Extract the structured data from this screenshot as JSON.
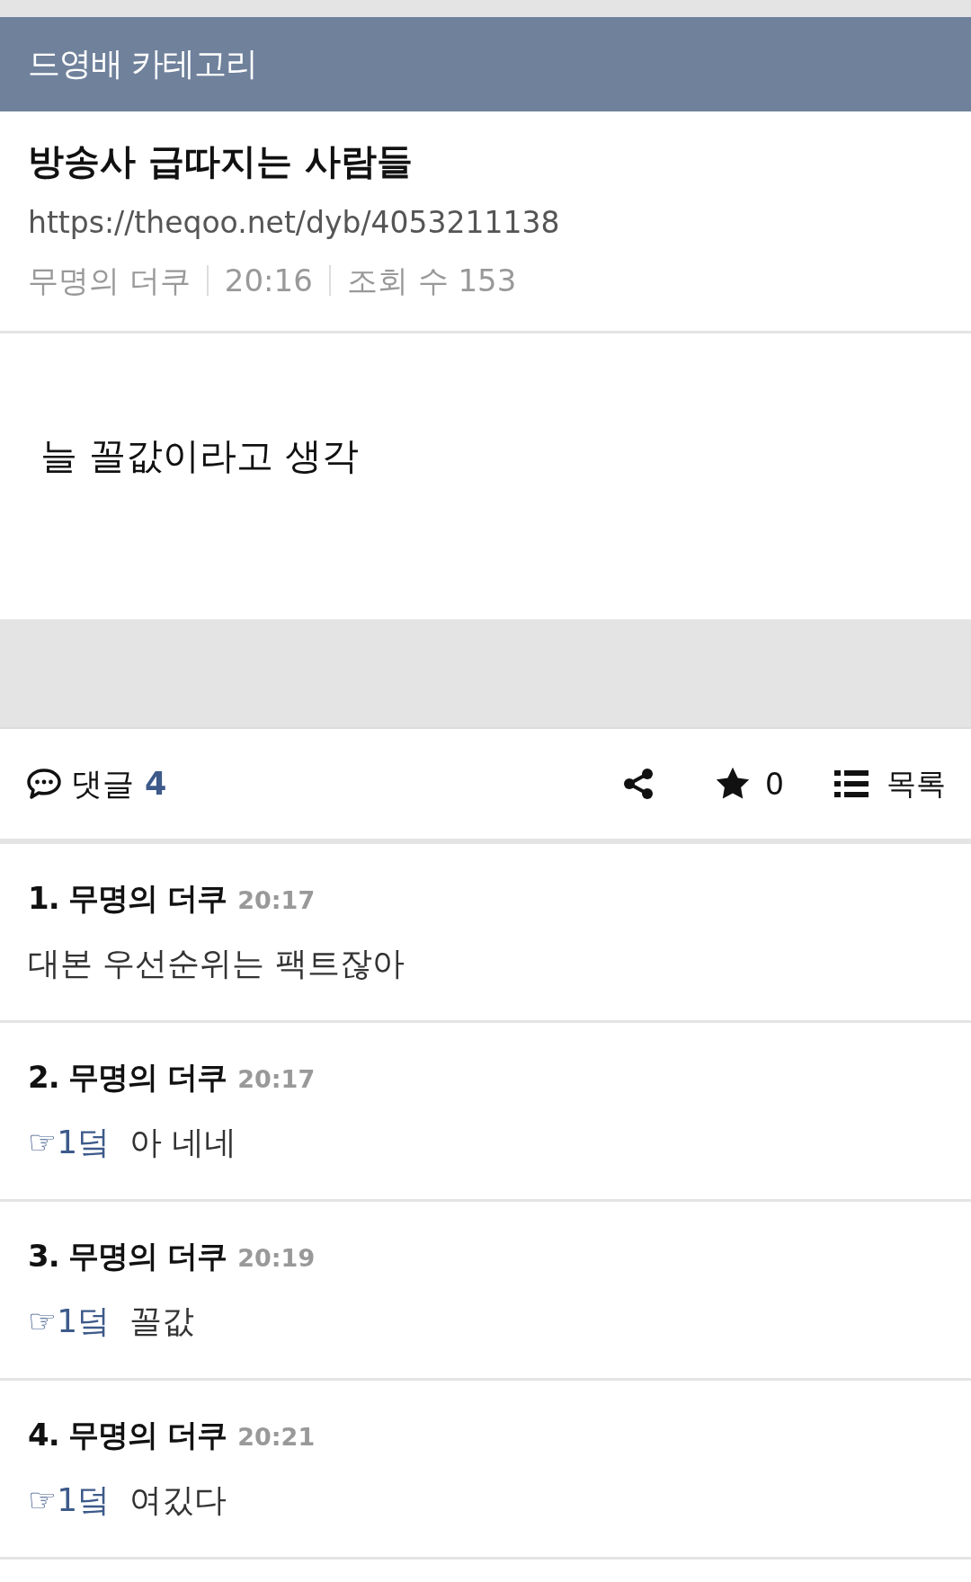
{
  "header": {
    "category": "드영배 카테고리"
  },
  "post": {
    "title": "방송사 급따지는 사람들",
    "url": "https://theqoo.net/dyb/4053211138",
    "author": "무명의 더쿠",
    "time": "20:16",
    "views": "조회 수 153",
    "body": "늘 꼴값이라고 생각"
  },
  "toolbar": {
    "comments_label": "댓글",
    "comments_count": "4",
    "stars": "0",
    "list_label": "목록"
  },
  "comments": [
    {
      "number": "1.",
      "author": "무명의 더쿠",
      "time": "20:17",
      "text": "대본 우선순위는 팩트잖아"
    },
    {
      "number": "2.",
      "author": "무명의 더쿠",
      "time": "20:17",
      "reply_to": "☞1덬",
      "text": "아 네네"
    },
    {
      "number": "3.",
      "author": "무명의 더쿠",
      "time": "20:19",
      "reply_to": "☞1덬",
      "text": "꼴값"
    },
    {
      "number": "4.",
      "author": "무명의 더쿠",
      "time": "20:21",
      "reply_to": "☞1덬",
      "text": "여깄다"
    }
  ]
}
